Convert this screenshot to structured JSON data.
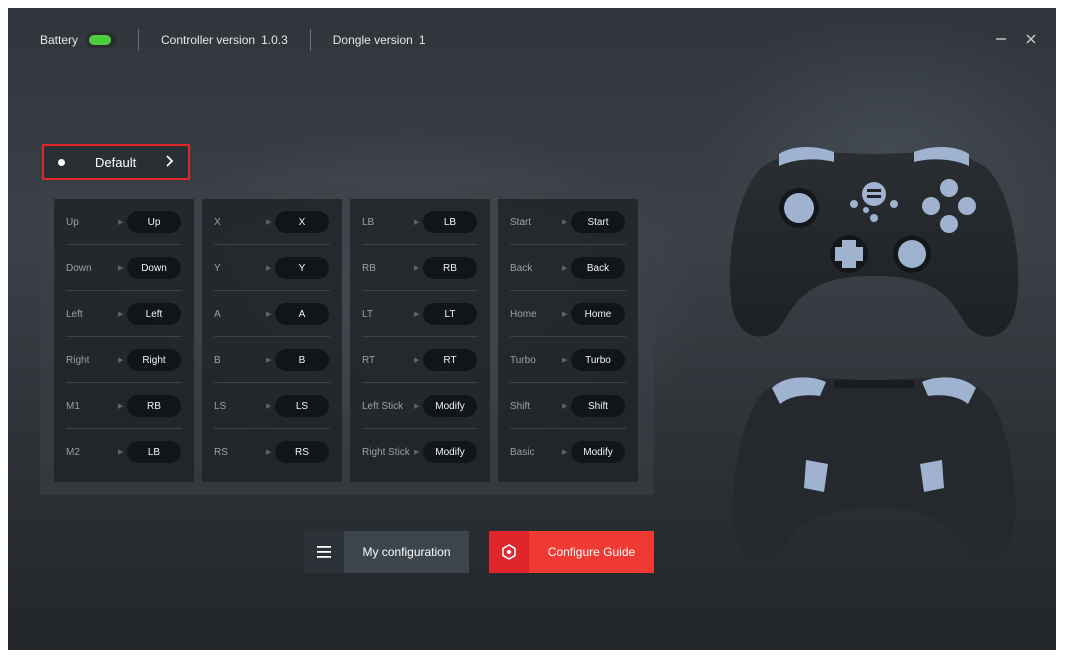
{
  "titlebar": {
    "battery_label": "Battery",
    "battery_level_pct": 100,
    "battery_color": "#4ccd3e",
    "controller_version_label": "Controller version",
    "controller_version_value": "1.0.3",
    "dongle_version_label": "Dongle version",
    "dongle_version_value": "1",
    "minimize_icon": "minimize-icon",
    "close_icon": "close-icon"
  },
  "profile": {
    "name": "Default",
    "highlight_color": "#e0262b"
  },
  "mapping": {
    "columns": [
      {
        "rows": [
          {
            "label": "Up",
            "value": "Up"
          },
          {
            "label": "Down",
            "value": "Down"
          },
          {
            "label": "Left",
            "value": "Left"
          },
          {
            "label": "Right",
            "value": "Right"
          },
          {
            "label": "M1",
            "value": "RB"
          },
          {
            "label": "M2",
            "value": "LB"
          }
        ]
      },
      {
        "rows": [
          {
            "label": "X",
            "value": "X"
          },
          {
            "label": "Y",
            "value": "Y"
          },
          {
            "label": "A",
            "value": "A"
          },
          {
            "label": "B",
            "value": "B"
          },
          {
            "label": "LS",
            "value": "LS"
          },
          {
            "label": "RS",
            "value": "RS"
          }
        ]
      },
      {
        "rows": [
          {
            "label": "LB",
            "value": "LB"
          },
          {
            "label": "RB",
            "value": "RB"
          },
          {
            "label": "LT",
            "value": "LT"
          },
          {
            "label": "RT",
            "value": "RT"
          },
          {
            "label": "Left Stick",
            "value": "Modify"
          },
          {
            "label": "Right Stick",
            "value": "Modify"
          }
        ]
      },
      {
        "rows": [
          {
            "label": "Start",
            "value": "Start"
          },
          {
            "label": "Back",
            "value": "Back"
          },
          {
            "label": "Home",
            "value": "Home"
          },
          {
            "label": "Turbo",
            "value": "Turbo"
          },
          {
            "label": "Shift",
            "value": "Shift"
          },
          {
            "label": "Basic",
            "value": "Modify"
          }
        ]
      }
    ]
  },
  "actions": {
    "my_config_label": "My configuration",
    "my_config_icon": "menu-icon",
    "guide_label": "Configure Guide",
    "guide_icon": "target-icon",
    "guide_color": "#ef3a33"
  },
  "illustrations": {
    "front_view": "controller-front-illustration",
    "back_view": "controller-back-illustration",
    "accent_color": "#9fb2d0"
  }
}
